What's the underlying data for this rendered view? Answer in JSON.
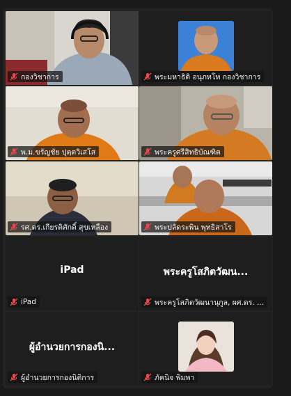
{
  "participants": [
    {
      "name": "กองวิชาการ",
      "muted": true,
      "active": false,
      "type": "video"
    },
    {
      "name": "พระมหาธิติ อนุภทโท กองวิชาการ",
      "muted": true,
      "active": false,
      "type": "photo"
    },
    {
      "name": "พ.ม.ขรัญชัย ปุตฺตวิเสโส",
      "muted": true,
      "active": true,
      "type": "video"
    },
    {
      "name": "พระครูศรีสิทธิบัณฑิต",
      "muted": true,
      "active": false,
      "type": "video"
    },
    {
      "name": "รศ.ดร.เกียรติศักดิ์ สุขเหลือง",
      "muted": true,
      "active": false,
      "type": "video"
    },
    {
      "name": "พระปลัดระพิน พุทธิสาโร",
      "muted": true,
      "active": false,
      "type": "video"
    },
    {
      "name": "iPad",
      "display": "iPad",
      "muted": true,
      "active": false,
      "type": "name"
    },
    {
      "name": "พระครูโสภิตวัฒนานุกูล, ผศ.ดร. ...",
      "display": "พระครูโสภิตวัฒน...",
      "muted": true,
      "active": false,
      "type": "name"
    },
    {
      "name": "ผู้อำนวยการกองนิติการ",
      "display": "ผู้อำนวยการกองนิ...",
      "muted": true,
      "active": false,
      "type": "name"
    },
    {
      "name": "ภัคนิจ พิมพา",
      "muted": true,
      "active": false,
      "type": "photo"
    }
  ],
  "colors": {
    "active_border": "#3cc47a",
    "muted_icon": "#e5484d",
    "background": "#1a1a1a",
    "panel": "#232323"
  }
}
